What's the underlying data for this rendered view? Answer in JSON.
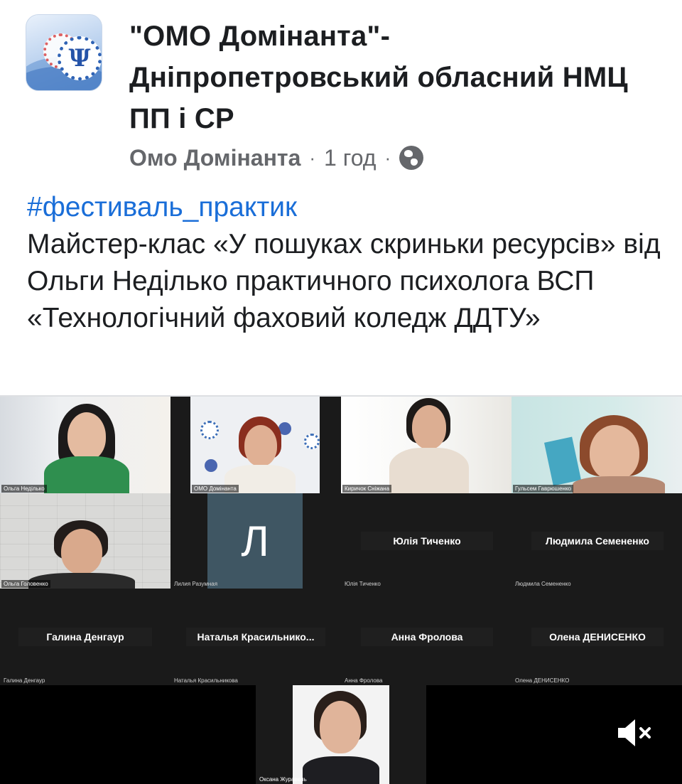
{
  "post": {
    "page_name": "\"ОМО Домінанта\"-Дніпропетровський обласний НМЦ ПП і СР",
    "author": "Омо Домінанта",
    "separator": "·",
    "time": "1 год",
    "hashtag": "#фестиваль_практик",
    "body": "Майстер-клас «У пошуках скриньки ресурсів» від Ольги Неділько практичного психолога ВСП «Технологічний фаховий коледж ДДТУ»",
    "avatar_glyph": "Ψ",
    "privacy_icon": "globe-icon"
  },
  "video": {
    "participants": [
      {
        "caption": "Ольга Неділько"
      },
      {
        "caption": "ОМО Домінанта"
      },
      {
        "caption": "Киричок Сніжана"
      },
      {
        "caption": "Гульсем Гаврюшенко"
      },
      {
        "caption": "Ольга Головенко"
      },
      {
        "caption": "Лилия Разумная",
        "initial": "Л"
      },
      {
        "caption": "Юлія Тиченко",
        "nameplate": "Юлія Тиченко"
      },
      {
        "caption": "Людмила Семененко",
        "nameplate": "Людмила Семененко"
      },
      {
        "caption": "Галина Денгаур",
        "nameplate": "Галина Денгаур"
      },
      {
        "caption": "Наталья Красильникова",
        "nameplate": "Наталья  Красильнико..."
      },
      {
        "caption": "Анна Фролова",
        "nameplate": "Анна Фролова"
      },
      {
        "caption": "Олена ДЕНИСЕНКО",
        "nameplate": "Олена ДЕНИСЕНКО"
      },
      {
        "caption": "Оксана Журавель"
      }
    ],
    "mute_icon": "speaker-muted-icon"
  },
  "colors": {
    "hashtag": "#1a6ed8",
    "meta_text": "#65676b",
    "video_bg": "#1a1a1a"
  }
}
